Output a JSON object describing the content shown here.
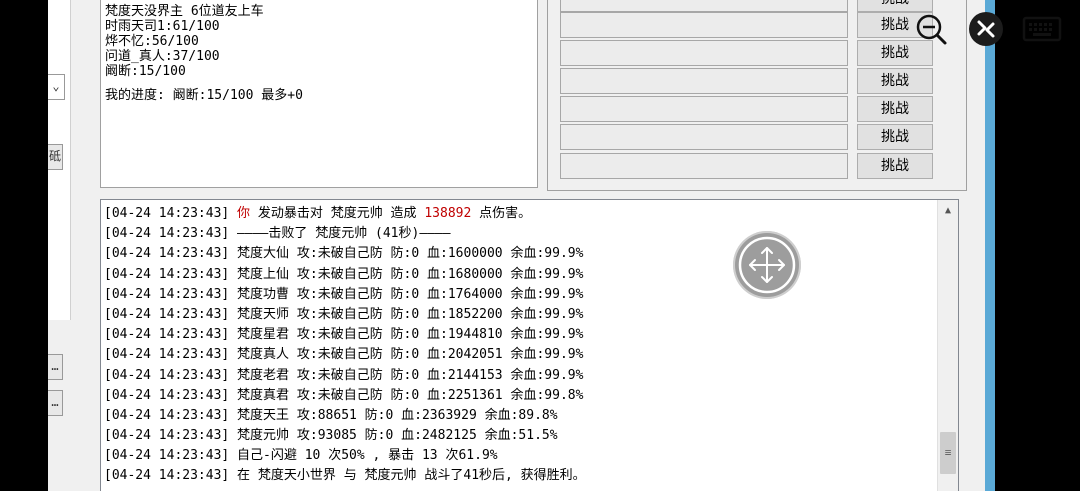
{
  "info_panel": {
    "lines": [
      "梵度天没界主 6位道友上车",
      "时雨天司1:61/100",
      "烨不忆:56/100",
      "问道_真人:37/100",
      "阚断:15/100"
    ],
    "progress": "我的进度: 阚断:15/100 最多+0"
  },
  "left_strip": {
    "select_arrow": "⌄",
    "button1": "砥",
    "button2": "…",
    "button3": "…"
  },
  "challenge": {
    "buttons": [
      "挑战",
      "挑战",
      "挑战",
      "挑战",
      "挑战",
      "挑战",
      "挑战"
    ]
  },
  "log": {
    "lines": [
      {
        "ts": "[04-24 14:23:43]",
        "pre": "",
        "hi1": "你",
        "mid": " 发动暴击对 梵度元帅 造成 ",
        "hi2": "138892",
        "post": " 点伤害。"
      },
      {
        "ts": "[04-24 14:23:43]",
        "pre": " ————击败了 梵度元帅 (41秒)————",
        "hi1": "",
        "mid": "",
        "hi2": "",
        "post": ""
      },
      {
        "ts": "[04-24 14:23:43]",
        "pre": " 梵度大仙 攻:未破自己防 防:0 血:1600000 余血:99.9%",
        "hi1": "",
        "mid": "",
        "hi2": "",
        "post": ""
      },
      {
        "ts": "[04-24 14:23:43]",
        "pre": " 梵度上仙 攻:未破自己防 防:0 血:1680000 余血:99.9%",
        "hi1": "",
        "mid": "",
        "hi2": "",
        "post": ""
      },
      {
        "ts": "[04-24 14:23:43]",
        "pre": " 梵度功曹 攻:未破自己防 防:0 血:1764000 余血:99.9%",
        "hi1": "",
        "mid": "",
        "hi2": "",
        "post": ""
      },
      {
        "ts": "[04-24 14:23:43]",
        "pre": " 梵度天师 攻:未破自己防 防:0 血:1852200 余血:99.9%",
        "hi1": "",
        "mid": "",
        "hi2": "",
        "post": ""
      },
      {
        "ts": "[04-24 14:23:43]",
        "pre": " 梵度星君 攻:未破自己防 防:0 血:1944810 余血:99.9%",
        "hi1": "",
        "mid": "",
        "hi2": "",
        "post": ""
      },
      {
        "ts": "[04-24 14:23:43]",
        "pre": " 梵度真人 攻:未破自己防 防:0 血:2042051 余血:99.9%",
        "hi1": "",
        "mid": "",
        "hi2": "",
        "post": ""
      },
      {
        "ts": "[04-24 14:23:43]",
        "pre": " 梵度老君 攻:未破自己防 防:0 血:2144153 余血:99.9%",
        "hi1": "",
        "mid": "",
        "hi2": "",
        "post": ""
      },
      {
        "ts": "[04-24 14:23:43]",
        "pre": " 梵度真君 攻:未破自己防 防:0 血:2251361 余血:99.8%",
        "hi1": "",
        "mid": "",
        "hi2": "",
        "post": ""
      },
      {
        "ts": "[04-24 14:23:43]",
        "pre": " 梵度天王 攻:88651 防:0 血:2363929 余血:89.8%",
        "hi1": "",
        "mid": "",
        "hi2": "",
        "post": ""
      },
      {
        "ts": "[04-24 14:23:43]",
        "pre": " 梵度元帅 攻:93085 防:0 血:2482125 余血:51.5%",
        "hi1": "",
        "mid": "",
        "hi2": "",
        "post": ""
      },
      {
        "ts": "[04-24 14:23:43]",
        "pre": " 自己-闪避 10 次50% , 暴击 13 次61.9%",
        "hi1": "",
        "mid": "",
        "hi2": "",
        "post": ""
      },
      {
        "ts": "[04-24 14:23:43]",
        "pre": " 在 梵度天小世界 与 梵度元帅 战斗了41秒后, 获得胜利。",
        "hi1": "",
        "mid": "",
        "hi2": "",
        "post": ""
      }
    ],
    "scroll_up": "▲",
    "scroll_grip": "≡"
  },
  "colors": {
    "highlight": "#c00000",
    "edge_blue": "#5aa9d6"
  },
  "icons": [
    "zoom-out-icon",
    "remote-connect-icon",
    "keyboard-icon",
    "move-icon"
  ]
}
